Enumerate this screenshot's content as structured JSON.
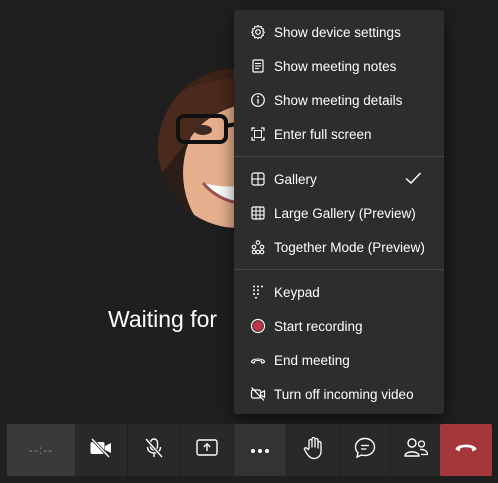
{
  "meeting": {
    "waiting_text": "Waiting for"
  },
  "menu": {
    "items": [
      {
        "label": "Show device settings",
        "icon": "gear-icon"
      },
      {
        "label": "Show meeting notes",
        "icon": "notes-icon"
      },
      {
        "label": "Show meeting details",
        "icon": "info-icon"
      },
      {
        "label": "Enter full screen",
        "icon": "fullscreen-icon"
      },
      {
        "label": "Gallery",
        "icon": "gallery-icon",
        "checked": true
      },
      {
        "label": "Large Gallery (Preview)",
        "icon": "large-gallery-icon"
      },
      {
        "label": "Together Mode (Preview)",
        "icon": "together-mode-icon"
      },
      {
        "label": "Keypad",
        "icon": "keypad-icon"
      },
      {
        "label": "Start recording",
        "icon": "record-icon"
      },
      {
        "label": "End meeting",
        "icon": "end-meeting-icon"
      },
      {
        "label": "Turn off incoming video",
        "icon": "video-off-icon"
      }
    ]
  },
  "toolbar": {
    "timer": "--:--",
    "buttons": [
      "camera-off-icon",
      "mic-off-icon",
      "share-screen-icon",
      "more-icon",
      "raise-hand-icon",
      "chat-icon",
      "participants-icon",
      "hang-up-icon"
    ]
  },
  "colors": {
    "background": "#1f1f1f",
    "menu_bg": "#2d2d2d",
    "toolbar_bg": "#292929",
    "hangup": "#a4373a",
    "record": "#c4314b"
  }
}
